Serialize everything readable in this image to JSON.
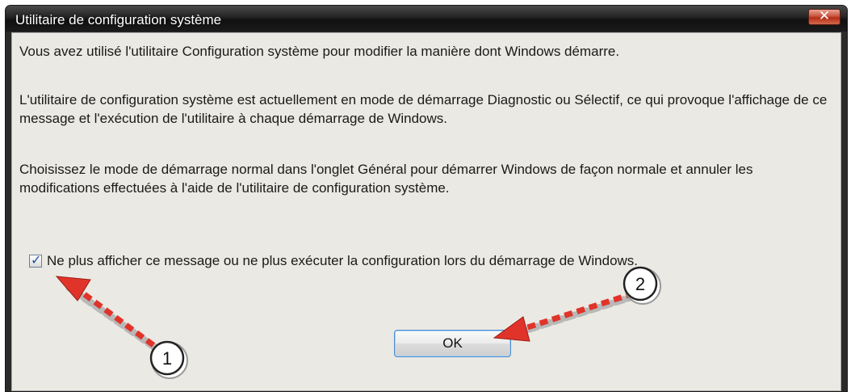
{
  "window": {
    "title": "Utilitaire de configuration système"
  },
  "message": {
    "paragraph1": "Vous avez utilisé l'utilitaire Configuration système pour modifier la manière dont Windows démarre.",
    "paragraph2": "L'utilitaire de configuration système est actuellement en mode de démarrage Diagnostic ou Sélectif, ce qui provoque l'affichage de ce message et l'exécution de l'utilitaire à chaque démarrage de Windows.",
    "paragraph3": "Choisissez le mode de démarrage normal dans l'onglet Général pour démarrer Windows de façon normale et annuler les modifications effectuées à l'aide de l'utilitaire de configuration système."
  },
  "checkbox": {
    "label": "Ne plus afficher ce message ou ne plus exécuter la configuration lors du démarrage de Windows.",
    "checked": true
  },
  "buttons": {
    "ok_label": "OK"
  },
  "annotations": {
    "callout1_label": "1",
    "callout2_label": "2",
    "arrow_color": "#e0342a"
  },
  "icons": {
    "close": "close-icon",
    "check": "check-icon"
  }
}
